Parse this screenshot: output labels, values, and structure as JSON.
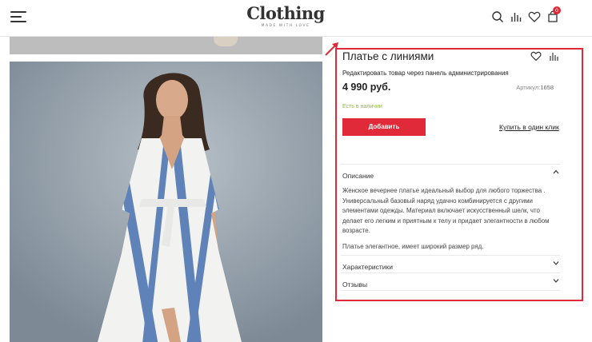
{
  "header": {
    "logo_title": "Clothing",
    "logo_tagline": "MADE WITH LOVE",
    "icons": [
      "menu-icon",
      "search-icon",
      "compare-icon",
      "heart-icon",
      "cart-icon"
    ],
    "cart_count": "0"
  },
  "product": {
    "title": "Платье с линиями",
    "edit_link": "Редактировать товар через панель администрирования",
    "price": "4 990 руб.",
    "sku_label": "Артикул:",
    "sku_value": "1658",
    "stock": "Есть в наличии",
    "add_button": "Добавить",
    "one_click": "Купить в один клик"
  },
  "accordion": {
    "description_title": "Описание",
    "description_p1": "Женское вечернее  платье идеальный выбор для любого торжества . Универсальный базовый наряд удачно комбинируется с другими элементами одежды. Материал включает искусственный шелк, что делает его легким и приятным к телу и придает элегантности в любом возрасте.",
    "description_p2": "Платье элегантное, имеет широкий размер ряд.",
    "characteristics_title": "Характеристики",
    "reviews_title": "Отзывы"
  },
  "colors": {
    "accent": "#e02a3a",
    "stock_green": "#8dbd2b",
    "dress_stripe": "#5f83b8",
    "background_photo": "#8e9aa5"
  }
}
